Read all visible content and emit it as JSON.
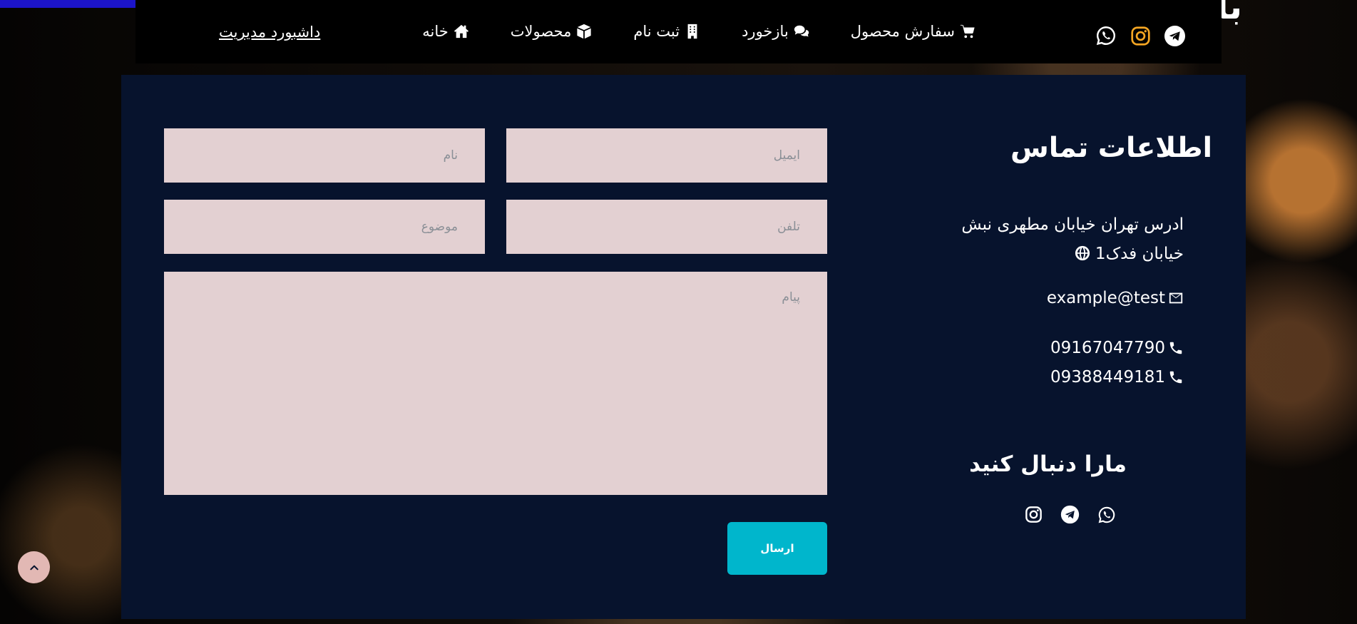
{
  "corner_text": "با",
  "colors": {
    "nav_bg": "#000000",
    "panel_bg": "#07132d",
    "field_bg": "#e3d0d2",
    "send_button": "#00b6cc",
    "accent_bar": "#1c14c9",
    "instagram_orange": "#f5a623",
    "scroll_top": "#e2b8b4"
  },
  "navbar": {
    "social_icons": [
      "telegram-icon",
      "instagram-icon",
      "whatsapp-icon"
    ],
    "menu": [
      {
        "label": "سفارش محصول",
        "icon": "cart-icon"
      },
      {
        "label": "بازخورد",
        "icon": "comments-icon"
      },
      {
        "label": "ثبت نام",
        "icon": "building-icon"
      },
      {
        "label": "محصولات",
        "icon": "box-icon"
      },
      {
        "label": "خانه",
        "icon": "home-icon"
      }
    ],
    "dashboard_link": "داشبورد مدیریت"
  },
  "contact": {
    "title": "اطلاعات تماس",
    "address": "ادرس تهران خیابان مطهری نبش خیابان فدک1",
    "email": "example@test",
    "phones": [
      "09167047790",
      "09388449181"
    ],
    "follow_title": "مارا دنبال کنید",
    "social_icons": [
      "whatsapp-icon",
      "telegram-icon",
      "instagram-icon"
    ]
  },
  "form": {
    "email_placeholder": "ایمیل",
    "name_placeholder": "نام",
    "phone_placeholder": "تلفن",
    "subject_placeholder": "موضوع",
    "message_placeholder": "پیام",
    "send_label": "ارسال"
  }
}
